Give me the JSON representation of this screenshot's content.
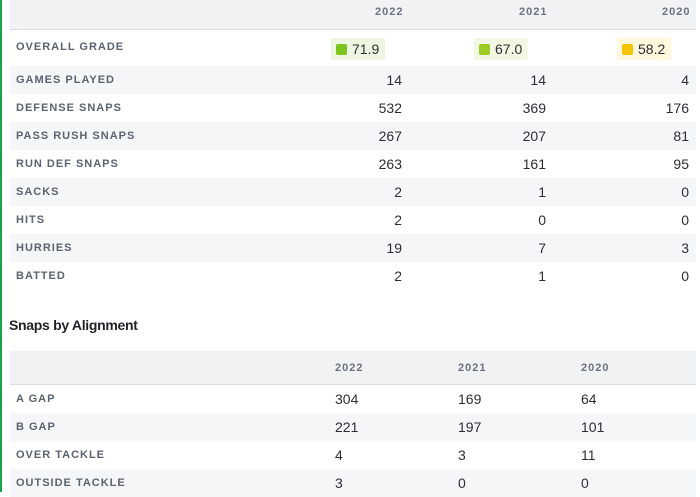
{
  "stats_table": {
    "years": [
      "2022",
      "2021",
      "2020"
    ],
    "grade": {
      "label": "OVERALL GRADE",
      "values": [
        "71.9",
        "67.0",
        "58.2"
      ],
      "colors": [
        "#7cc31e",
        "#9ccb24",
        "#f5c400"
      ],
      "backgrounds": [
        "#eef6e1",
        "#f2f7e3",
        "#fff8dc"
      ]
    },
    "rows": [
      {
        "label": "GAMES PLAYED",
        "values": [
          "14",
          "14",
          "4"
        ]
      },
      {
        "label": "DEFENSE SNAPS",
        "values": [
          "532",
          "369",
          "176"
        ]
      },
      {
        "label": "PASS RUSH SNAPS",
        "values": [
          "267",
          "207",
          "81"
        ]
      },
      {
        "label": "RUN DEF SNAPS",
        "values": [
          "263",
          "161",
          "95"
        ]
      },
      {
        "label": "SACKS",
        "values": [
          "2",
          "1",
          "0"
        ]
      },
      {
        "label": "HITS",
        "values": [
          "2",
          "0",
          "0"
        ]
      },
      {
        "label": "HURRIES",
        "values": [
          "19",
          "7",
          "3"
        ]
      },
      {
        "label": "BATTED",
        "values": [
          "2",
          "1",
          "0"
        ]
      }
    ]
  },
  "alignment_section": {
    "title": "Snaps by Alignment",
    "years": [
      "2022",
      "2021",
      "2020"
    ],
    "rows": [
      {
        "label": "A GAP",
        "values": [
          "304",
          "169",
          "64"
        ]
      },
      {
        "label": "B GAP",
        "values": [
          "221",
          "197",
          "101"
        ]
      },
      {
        "label": "OVER TACKLE",
        "values": [
          "4",
          "3",
          "11"
        ]
      },
      {
        "label": "OUTSIDE TACKLE",
        "values": [
          "3",
          "0",
          "0"
        ]
      }
    ]
  }
}
